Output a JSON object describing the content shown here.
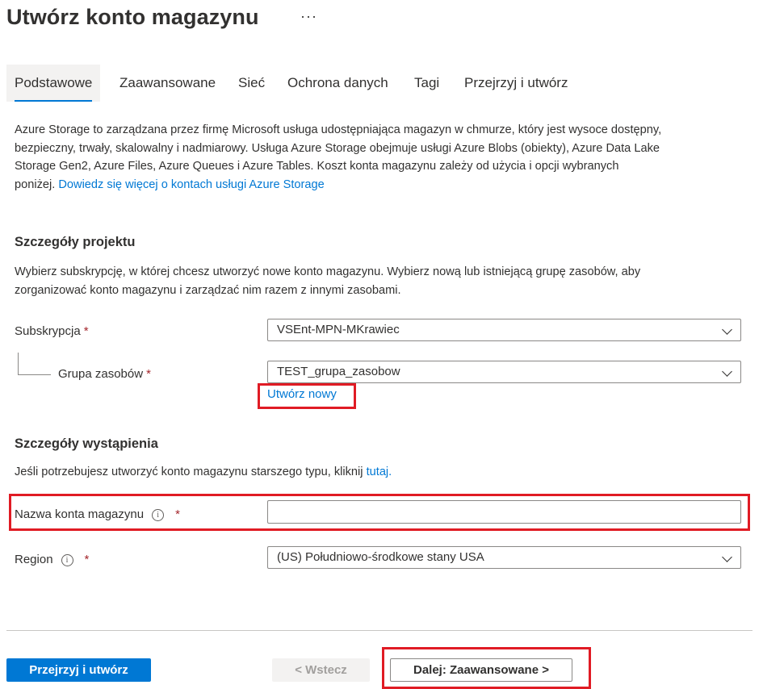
{
  "header": {
    "title": "Utwórz konto magazynu",
    "more": "···"
  },
  "tabs": [
    {
      "label": "Podstawowe"
    },
    {
      "label": "Zaawansowane"
    },
    {
      "label": "Sieć"
    },
    {
      "label": "Ochrona danych"
    },
    {
      "label": "Tagi"
    },
    {
      "label": "Przejrzyj i utwórz"
    }
  ],
  "intro": {
    "line1": "Azure Storage to zarządzana przez firmę Microsoft usługa udostępniająca magazyn w chmurze, który jest wysoce dostępny,",
    "line2": "bezpieczny, trwały, skalowalny i nadmiarowy. Usługa Azure Storage obejmuje usługi Azure Blobs (obiekty), Azure Data Lake",
    "line3": "Storage Gen2, Azure Files, Azure Queues i Azure Tables. Koszt konta magazynu zależy od użycia i opcji wybranych",
    "line4": "poniżej.",
    "link": "Dowiedz się więcej o kontach usługi Azure Storage"
  },
  "project": {
    "heading": "Szczegóły projektu",
    "desc1": "Wybierz subskrypcję, w której chcesz utworzyć nowe konto magazynu. Wybierz nową lub istniejącą grupę zasobów, aby",
    "desc2": "zorganizować konto magazynu i zarządzać nim razem z innymi zasobami.",
    "subscription_label": "Subskrypcja",
    "subscription_value": "VSEnt-MPN-MKrawiec",
    "rg_label": "Grupa zasobów",
    "rg_value": "TEST_grupa_zasobow",
    "create_new": "Utwórz nowy",
    "required_mark": "*"
  },
  "instance": {
    "heading": "Szczegóły wystąpienia",
    "desc": "Jeśli potrzebujesz utworzyć konto magazynu starszego typu, kliknij",
    "desc_link": "tutaj.",
    "name_label": "Nazwa konta magazynu",
    "name_value": "",
    "region_label": "Region",
    "region_value": "(US) Południowo-środkowe stany USA",
    "info_glyph": "i",
    "required_mark": "*"
  },
  "footer": {
    "review_create": "Przejrzyj i utwórz",
    "back": "< Wstecz",
    "next": "Dalej: Zaawansowane >"
  },
  "colors": {
    "accent": "#0078d4",
    "highlight": "#e01b24",
    "required": "#a4262c"
  }
}
